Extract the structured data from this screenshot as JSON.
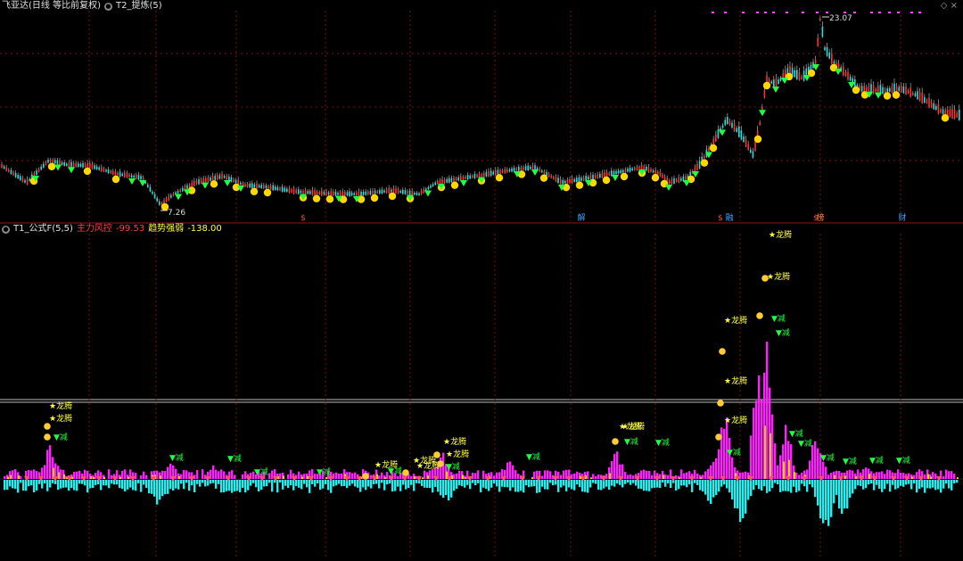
{
  "header_top": {
    "stock_label": "飞亚达(日线 等比前复权)",
    "indicator_label": "T2_提炼(5)"
  },
  "header_bottom": {
    "formula_label": "T1_公式F(5,5)",
    "risk_label": "主力风控",
    "risk_value": "-99.53",
    "trend_label": "趋势强弱",
    "trend_value": "-138.00"
  },
  "price_chart": {
    "high_label": "23.07",
    "low_label": "7.26"
  },
  "event_markers": [
    {
      "text": "$",
      "color": "#ff4040"
    },
    {
      "text": "解",
      "color": "#40a0ff"
    },
    {
      "text": "$",
      "color": "#ff4040"
    },
    {
      "text": "融",
      "color": "#40a0ff"
    },
    {
      "text": "$",
      "color": "#ff4040"
    },
    {
      "text": "榜",
      "color": "#ff8040"
    },
    {
      "text": "财",
      "color": "#40a0ff"
    }
  ],
  "signal_labels": {
    "dragon": "龙腾",
    "reduce": "减"
  },
  "colors": {
    "magenta": "#ff20ff",
    "cyan": "#20ffff",
    "yellow": "#ffff00",
    "green": "#20ff20",
    "gold": "#ffd000",
    "grid_red": "#7a1010"
  },
  "chart_data": {
    "type": "line",
    "title": "",
    "series": [
      {
        "name": "price",
        "high": 23.07,
        "low": 7.26
      }
    ]
  }
}
